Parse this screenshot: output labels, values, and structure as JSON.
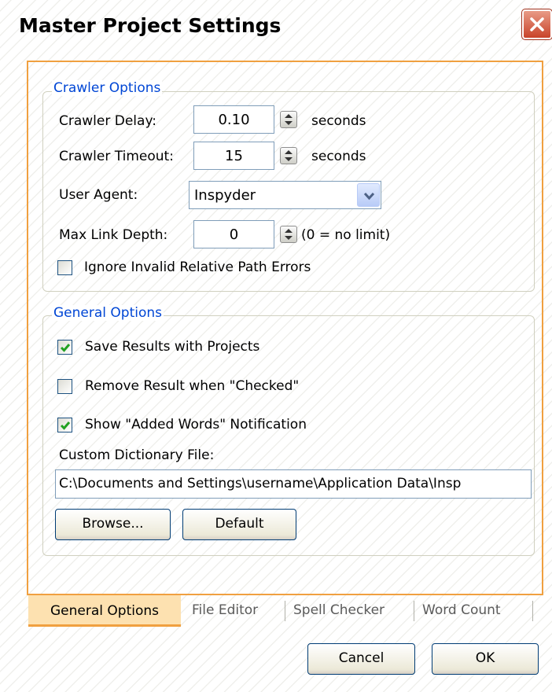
{
  "window": {
    "title": "Master Project Settings"
  },
  "crawler": {
    "legend": "Crawler Options",
    "delay_label": "Crawler Delay:",
    "delay_value": "0.10",
    "delay_unit": "seconds",
    "timeout_label": "Crawler Timeout:",
    "timeout_value": "15",
    "timeout_unit": "seconds",
    "agent_label": "User Agent:",
    "agent_value": "Inspyder",
    "depth_label": "Max Link Depth:",
    "depth_value": "0",
    "depth_note": "(0 = no limit)",
    "ignore_label": "Ignore Invalid Relative Path Errors",
    "ignore_checked": false
  },
  "general": {
    "legend": "General Options",
    "save_label": "Save Results with Projects",
    "save_checked": true,
    "remove_label": "Remove Result when \"Checked\"",
    "remove_checked": false,
    "show_label": "Show \"Added Words\" Notification",
    "show_checked": true,
    "dict_label": "Custom Dictionary File:",
    "dict_value": "C:\\Documents and Settings\\username\\Application Data\\Insp",
    "browse_label": "Browse...",
    "default_label": "Default"
  },
  "tabs": [
    {
      "label": "General Options",
      "active": true
    },
    {
      "label": "File Editor",
      "active": false
    },
    {
      "label": "Spell Checker",
      "active": false
    },
    {
      "label": "Word Count",
      "active": false
    }
  ],
  "footer": {
    "cancel_label": "Cancel",
    "ok_label": "OK"
  },
  "colors": {
    "accent_orange": "#f0a040",
    "legend_blue": "#0046d5",
    "check_green": "#21a121",
    "close_red": "#c9432a"
  }
}
